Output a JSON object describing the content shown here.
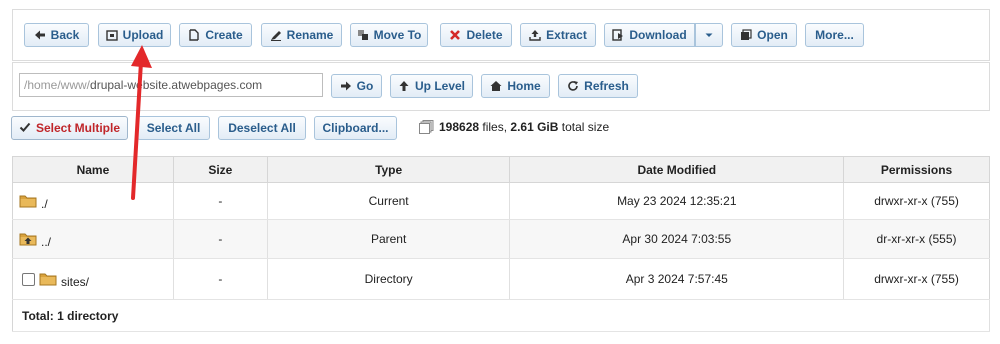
{
  "toolbar": {
    "back": "Back",
    "upload": "Upload",
    "create": "Create",
    "rename": "Rename",
    "move_to": "Move To",
    "delete": "Delete",
    "extract": "Extract",
    "download": "Download",
    "open": "Open",
    "more": "More..."
  },
  "path_bar": {
    "path_prefix": "/home/www/",
    "path_rest": "drupal-website.atwebpages.com",
    "go": "Go",
    "up_level": "Up Level",
    "home": "Home",
    "refresh": "Refresh"
  },
  "selection": {
    "select_multiple": "Select Multiple",
    "select_all": "Select All",
    "deselect_all": "Deselect All",
    "clipboard": "Clipboard..."
  },
  "summary": {
    "file_count": "198628",
    "files_label": " files, ",
    "total_size": "2.61 GiB",
    "size_label": " total size"
  },
  "table": {
    "headers": {
      "name": "Name",
      "size": "Size",
      "type": "Type",
      "date": "Date Modified",
      "permissions": "Permissions"
    },
    "rows": [
      {
        "name": "./",
        "size": "-",
        "type": "Current",
        "date": "May 23 2024 12:35:21",
        "permissions": "drwxr-xr-x (755)",
        "icon": "folder-icon"
      },
      {
        "name": "../",
        "size": "-",
        "type": "Parent",
        "date": "Apr 30 2024 7:03:55",
        "permissions": "dr-xr-xr-x (555)",
        "icon": "folder-up-icon"
      },
      {
        "name": "sites/",
        "size": "-",
        "type": "Directory",
        "date": "Apr 3 2024 7:57:45",
        "permissions": "drwxr-xr-x (755)",
        "icon": "folder-icon"
      }
    ],
    "total": "Total: 1 directory"
  },
  "colors": {
    "button_text": "#2a5d8c",
    "button_border": "#a9c4dc",
    "delete_icon": "#d42a2a",
    "select_multiple_text": "#c0262a",
    "annotation_arrow": "#e3282a",
    "folder": "#d9a23c"
  }
}
